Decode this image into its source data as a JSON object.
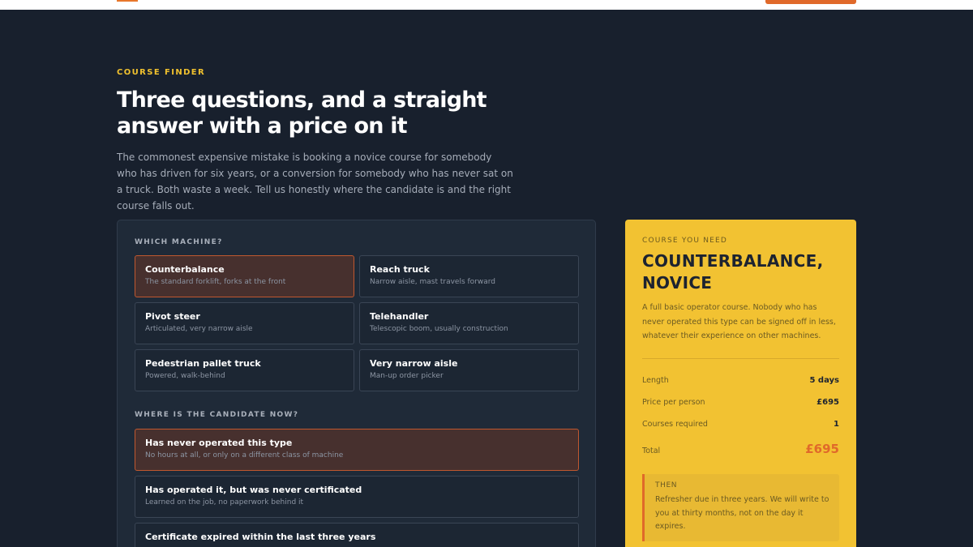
{
  "header": {
    "cta_color": "#e0692a"
  },
  "hero": {
    "eyebrow": "COURSE FINDER",
    "title": "Three questions, and a straight answer with a price on it",
    "intro": "The commonest expensive mistake is booking a novice course for somebody who has driven for six years, or a conversion for somebody who has never sat on a truck. Both waste a week. Tell us honestly where the candidate is and the right course falls out."
  },
  "finder": {
    "machine_label": "WHICH MACHINE?",
    "machines": [
      {
        "title": "Counterbalance",
        "sub": "The standard forklift, forks at the front",
        "selected": true
      },
      {
        "title": "Reach truck",
        "sub": "Narrow aisle, mast travels forward",
        "selected": false
      },
      {
        "title": "Pivot steer",
        "sub": "Articulated, very narrow aisle",
        "selected": false
      },
      {
        "title": "Telehandler",
        "sub": "Telescopic boom, usually construction",
        "selected": false
      },
      {
        "title": "Pedestrian pallet truck",
        "sub": "Powered, walk-behind",
        "selected": false
      },
      {
        "title": "Very narrow aisle",
        "sub": "Man-up order picker",
        "selected": false
      }
    ],
    "candidate_label": "WHERE IS THE CANDIDATE NOW?",
    "candidates": [
      {
        "title": "Has never operated this type",
        "sub": "No hours at all, or only on a different class of machine",
        "selected": true
      },
      {
        "title": "Has operated it, but was never certificated",
        "sub": "Learned on the job, no paperwork behind it",
        "selected": false
      },
      {
        "title": "Certificate expired within the last three years",
        "sub": "",
        "selected": false
      }
    ]
  },
  "result": {
    "eyebrow": "COURSE YOU NEED",
    "title": "COUNTERBALANCE, NOVICE",
    "description": "A full basic operator course. Nobody who has never operated this type can be signed off in less, whatever their experience on other machines.",
    "rows": [
      {
        "key": "Length",
        "value": "5 days"
      },
      {
        "key": "Price per person",
        "value": "£695"
      },
      {
        "key": "Courses required",
        "value": "1"
      },
      {
        "key": "Total",
        "value": "£695"
      }
    ],
    "then_label": "THEN",
    "then_text": "Refresher due in three years. We will write to you at thirty months, not on the day it expires."
  },
  "colors": {
    "background": "#18202d",
    "accent": "#f0c12e",
    "selected_border": "#c0582f",
    "result_panel": "#f2c232",
    "total_price": "#e0692a"
  }
}
